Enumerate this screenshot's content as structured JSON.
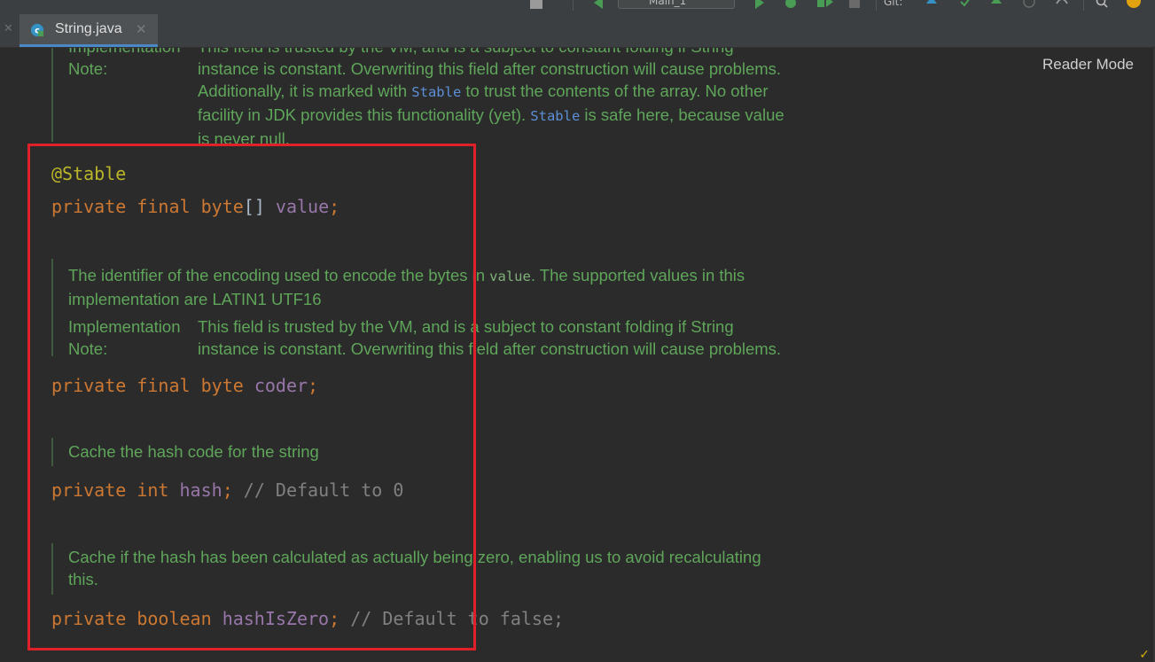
{
  "toolbar": {
    "run_config_label": "Main_1",
    "git_label": "Git:"
  },
  "tabs": [
    {
      "label": "String.java",
      "icon": "java-class-icon",
      "active": true
    }
  ],
  "editor": {
    "reader_mode_label": "Reader Mode",
    "top_doc": {
      "impl_key_1": "Implementation",
      "impl_key_2": "Note:",
      "line1": "This field is trusted by the VM, and is a subject to constant folding if String",
      "line2": "instance is constant. Overwriting this field after construction will cause problems.",
      "line3_a": "Additionally, it is marked with ",
      "line3_code": "Stable",
      "line3_b": " to trust the contents of the array. No other",
      "line4_a": "facility in JDK provides this functionality (yet). ",
      "line4_code": "Stable",
      "line4_b": " is safe here, because value",
      "line5": "is never null."
    },
    "code_value": {
      "annotation": "@Stable",
      "kw1": "private",
      "kw2": "final",
      "type": "byte",
      "brackets": "[]",
      "name": "value",
      "semi": ";"
    },
    "coder_doc": {
      "line1_a": "The identifier of the encoding used to encode the bytes in ",
      "line1_code": "value",
      "line1_b": ". The supported values in this",
      "line2": "implementation are LATIN1 UTF16",
      "impl_key_1": "Implementation",
      "impl_key_2": "Note:",
      "impl_line1": "This field is trusted by the VM, and is a subject to constant folding if String",
      "impl_line2": "instance is constant. Overwriting this field after construction will cause problems."
    },
    "code_coder": {
      "kw1": "private",
      "kw2": "final",
      "type": "byte",
      "name": "coder",
      "semi": ";"
    },
    "hash_doc": {
      "line1": "Cache the hash code for the string"
    },
    "code_hash": {
      "kw1": "private",
      "type": "int",
      "name": "hash",
      "semi": ";",
      "comment": "// Default to 0"
    },
    "hashzero_doc": {
      "line1": "Cache if the hash has been calculated as actually being zero, enabling us to avoid recalculating",
      "line2": "this."
    },
    "code_hashzero": {
      "kw1": "private",
      "type": "boolean",
      "name": "hashIsZero",
      "semi": ";",
      "comment": "// Default to false;"
    }
  },
  "colors": {
    "highlight_box": "#e0212a",
    "doc_text": "#5fa55a",
    "keyword": "#cc7832",
    "field": "#9876aa",
    "annotation": "#bbb529",
    "comment": "#808080"
  }
}
